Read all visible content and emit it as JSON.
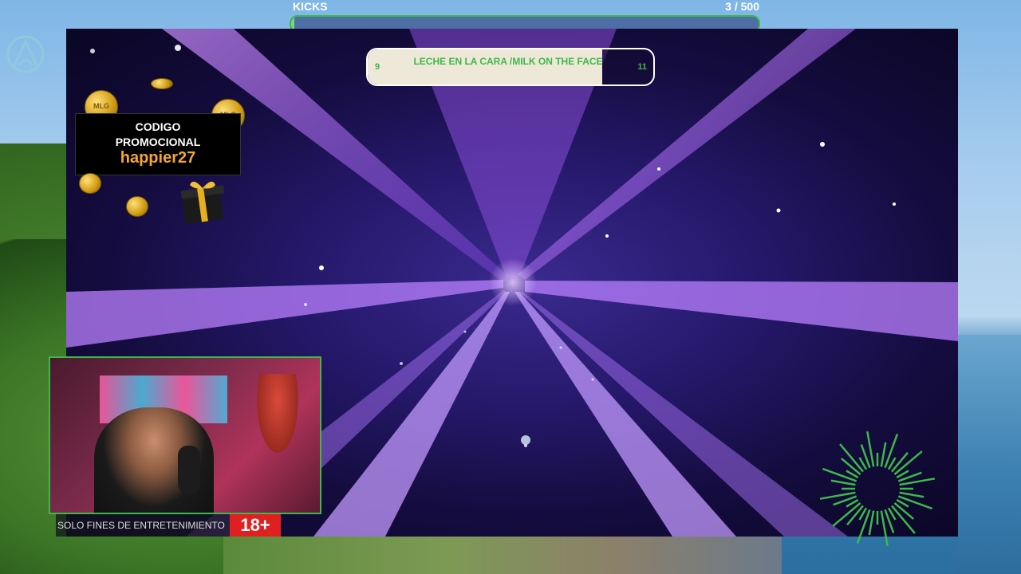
{
  "kicks": {
    "label": "KICKS",
    "current": 3,
    "goal": 500,
    "count_text": "3  / 500"
  },
  "score_pill": {
    "left_score": "9",
    "right_score": "11",
    "title": "LECHE EN LA CARA /MILK ON THE FACE",
    "fill_fraction": 0.82
  },
  "promo": {
    "line1": "CODIGO",
    "line2": "PROMOCIONAL",
    "code": "happier27",
    "coin_text": "MLG"
  },
  "disclaimer": {
    "text": "SOLO FINES DE ENTRETENIMIENTO",
    "age_badge": "18+"
  },
  "icons": {
    "logo": "sliced-circle-logo-icon",
    "gift": "gift-box-icon",
    "coin": "gold-coin-icon",
    "burst": "green-radial-burst-icon"
  },
  "colors": {
    "accent_green": "#3db84a",
    "promo_gold": "#f4a72b",
    "age_red": "#e02020",
    "tunnel_purple": "#b36bff"
  }
}
